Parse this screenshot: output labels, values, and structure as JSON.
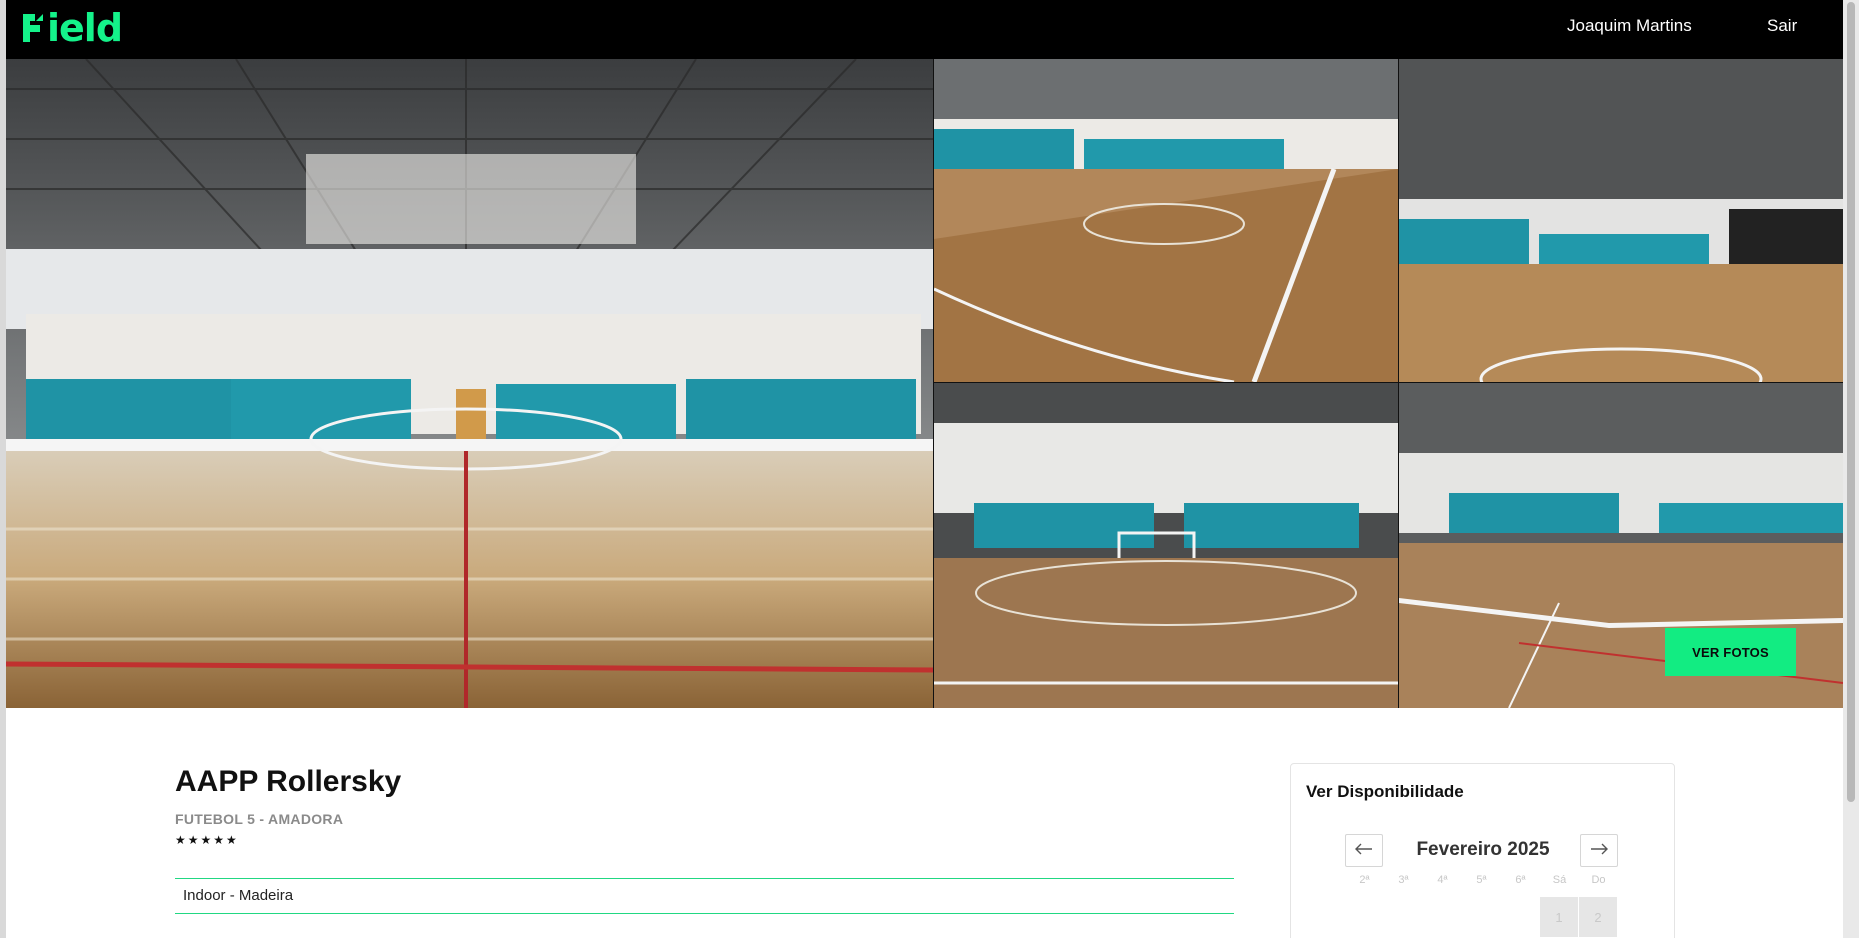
{
  "navbar": {
    "logo_text": "ield",
    "user_name": "Joaquim Martins",
    "exit_label": "Sair"
  },
  "gallery": {
    "button_label": "VER FOTOS"
  },
  "venue": {
    "name": "AAPP Rollersky",
    "subtitle": "FUTEBOL 5 - AMADORA",
    "rating_stars": "★★★★★",
    "rating": 4.5,
    "surface": "Indoor - Madeira"
  },
  "availability": {
    "title": "Ver Disponibilidade",
    "month": "Fevereiro 2025",
    "prev_icon": "arrow-left-icon",
    "next_icon": "arrow-right-icon",
    "weekdays": [
      "2ª",
      "3ª",
      "4ª",
      "5ª",
      "6ª",
      "Sá",
      "Do"
    ],
    "days": [
      "1",
      "2"
    ]
  },
  "colors": {
    "brand": "#14f28a",
    "button": "#12ec82",
    "navbar": "#000000"
  }
}
